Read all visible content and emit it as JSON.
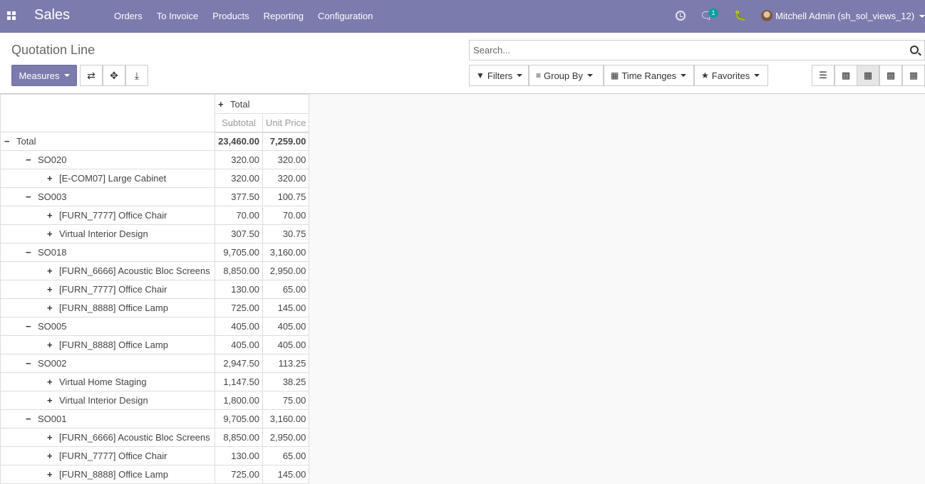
{
  "navbar": {
    "brand": "Sales",
    "menu": [
      "Orders",
      "To Invoice",
      "Products",
      "Reporting",
      "Configuration"
    ],
    "chat_count": "1",
    "user": "Mitchell Admin (sh_sol_views_12)"
  },
  "control_panel": {
    "breadcrumb": "Quotation Line",
    "measures_label": "Measures",
    "search_placeholder": "Search...",
    "filters_label": "Filters",
    "group_by_label": "Group By",
    "time_ranges_label": "Time Ranges",
    "favorites_label": "Favorites"
  },
  "pivot": {
    "col_header": "Total",
    "measures": [
      "Subtotal",
      "Unit Price"
    ],
    "rows": [
      {
        "level": 0,
        "sign": "minus",
        "label": "Total",
        "subtotal": "23,460.00",
        "unit_price": "7,259.00",
        "bold": true
      },
      {
        "level": 1,
        "sign": "minus",
        "label": "SO020",
        "subtotal": "320.00",
        "unit_price": "320.00"
      },
      {
        "level": 2,
        "sign": "plus",
        "label": "[E-COM07] Large Cabinet",
        "subtotal": "320.00",
        "unit_price": "320.00"
      },
      {
        "level": 1,
        "sign": "minus",
        "label": "SO003",
        "subtotal": "377.50",
        "unit_price": "100.75"
      },
      {
        "level": 2,
        "sign": "plus",
        "label": "[FURN_7777] Office Chair",
        "subtotal": "70.00",
        "unit_price": "70.00"
      },
      {
        "level": 2,
        "sign": "plus",
        "label": "Virtual Interior Design",
        "subtotal": "307.50",
        "unit_price": "30.75"
      },
      {
        "level": 1,
        "sign": "minus",
        "label": "SO018",
        "subtotal": "9,705.00",
        "unit_price": "3,160.00"
      },
      {
        "level": 2,
        "sign": "plus",
        "label": "[FURN_6666] Acoustic Bloc Screens",
        "subtotal": "8,850.00",
        "unit_price": "2,950.00"
      },
      {
        "level": 2,
        "sign": "plus",
        "label": "[FURN_7777] Office Chair",
        "subtotal": "130.00",
        "unit_price": "65.00"
      },
      {
        "level": 2,
        "sign": "plus",
        "label": "[FURN_8888] Office Lamp",
        "subtotal": "725.00",
        "unit_price": "145.00"
      },
      {
        "level": 1,
        "sign": "minus",
        "label": "SO005",
        "subtotal": "405.00",
        "unit_price": "405.00"
      },
      {
        "level": 2,
        "sign": "plus",
        "label": "[FURN_8888] Office Lamp",
        "subtotal": "405.00",
        "unit_price": "405.00"
      },
      {
        "level": 1,
        "sign": "minus",
        "label": "SO002",
        "subtotal": "2,947.50",
        "unit_price": "113.25"
      },
      {
        "level": 2,
        "sign": "plus",
        "label": "Virtual Home Staging",
        "subtotal": "1,147.50",
        "unit_price": "38.25"
      },
      {
        "level": 2,
        "sign": "plus",
        "label": "Virtual Interior Design",
        "subtotal": "1,800.00",
        "unit_price": "75.00"
      },
      {
        "level": 1,
        "sign": "minus",
        "label": "SO001",
        "subtotal": "9,705.00",
        "unit_price": "3,160.00"
      },
      {
        "level": 2,
        "sign": "plus",
        "label": "[FURN_6666] Acoustic Bloc Screens",
        "subtotal": "8,850.00",
        "unit_price": "2,950.00"
      },
      {
        "level": 2,
        "sign": "plus",
        "label": "[FURN_7777] Office Chair",
        "subtotal": "130.00",
        "unit_price": "65.00"
      },
      {
        "level": 2,
        "sign": "plus",
        "label": "[FURN_8888] Office Lamp",
        "subtotal": "725.00",
        "unit_price": "145.00"
      }
    ]
  }
}
